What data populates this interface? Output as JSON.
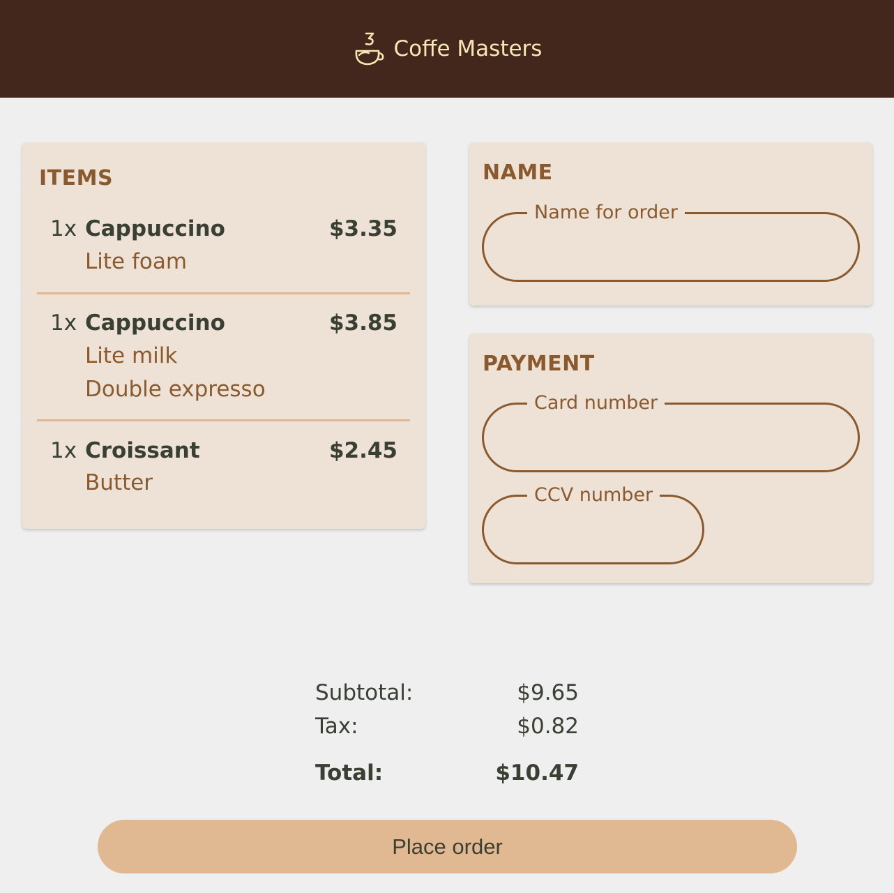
{
  "header": {
    "brand_name": "Coffe Masters",
    "logo_icon": "coffee-cup-icon",
    "background_color": "#43271d",
    "text_color": "#f6e7b4"
  },
  "items_card": {
    "title": "ITEMS",
    "items": [
      {
        "qty": "1x",
        "name": "Cappuccino",
        "price": "$3.35",
        "options": [
          "Lite foam"
        ]
      },
      {
        "qty": "1x",
        "name": "Cappuccino",
        "price": "$3.85",
        "options": [
          "Lite milk",
          "Double expresso"
        ]
      },
      {
        "qty": "1x",
        "name": "Croissant",
        "price": "$2.45",
        "options": [
          "Butter"
        ]
      }
    ]
  },
  "name_card": {
    "title": "NAME",
    "name_field": {
      "label": "Name for order",
      "value": ""
    }
  },
  "payment_card": {
    "title": "PAYMENT",
    "card_field": {
      "label": "Card number",
      "value": ""
    },
    "ccv_field": {
      "label": "CCV number",
      "value": ""
    }
  },
  "summary": {
    "subtotal_label": "Subtotal:",
    "subtotal_value": "$9.65",
    "tax_label": "Tax:",
    "tax_value": "$0.82",
    "total_label": "Total:",
    "total_value": "$10.47"
  },
  "actions": {
    "place_order_label": "Place order",
    "button_color": "#e0b892"
  },
  "colors": {
    "accent": "#8a5a2e",
    "card_background": "#eee2d7",
    "separator": "#e1b793",
    "text_dark": "#3a3f34"
  }
}
